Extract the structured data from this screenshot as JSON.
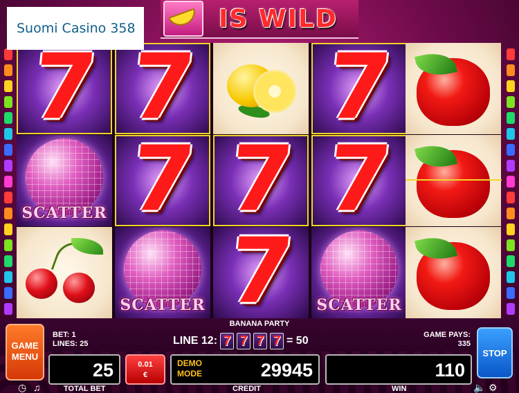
{
  "brand": {
    "label": "Suomi Casino 358"
  },
  "banner": {
    "text": "IS WILD",
    "icon": "banana-wild-icon"
  },
  "reels": [
    [
      "seven",
      "scatter",
      "cherry"
    ],
    [
      "seven",
      "seven",
      "scatter"
    ],
    [
      "lemon",
      "seven",
      "seven"
    ],
    [
      "seven",
      "seven",
      "scatter"
    ],
    [
      "apple",
      "apple",
      "apple"
    ]
  ],
  "scatter_text": "SCATTER",
  "panel": {
    "menu_label_1": "GAME",
    "menu_label_2": "MENU",
    "bet_line": "BET: 1",
    "lines_line": "LINES: 25",
    "game_title": "BANANA PARTY",
    "line_win_label": "LINE 12:",
    "line_symbols": [
      "7",
      "7",
      "7",
      "7"
    ],
    "line_win_value": "= 50",
    "game_pays_label": "GAME PAYS:",
    "game_pays_value": "335",
    "total_bet_value": "25",
    "total_bet_label": "TOTAL BET",
    "coin_value": "0.01",
    "coin_currency": "€",
    "demo_label_1": "DEMO",
    "demo_label_2": "MODE",
    "credit_value": "29945",
    "credit_label": "CREDIT",
    "win_value": "110",
    "win_label": "WIN",
    "stop_label": "STOP"
  },
  "colors": {
    "accent": "#f2d42a",
    "menu": "#e8551a",
    "stop": "#1a78e6"
  }
}
